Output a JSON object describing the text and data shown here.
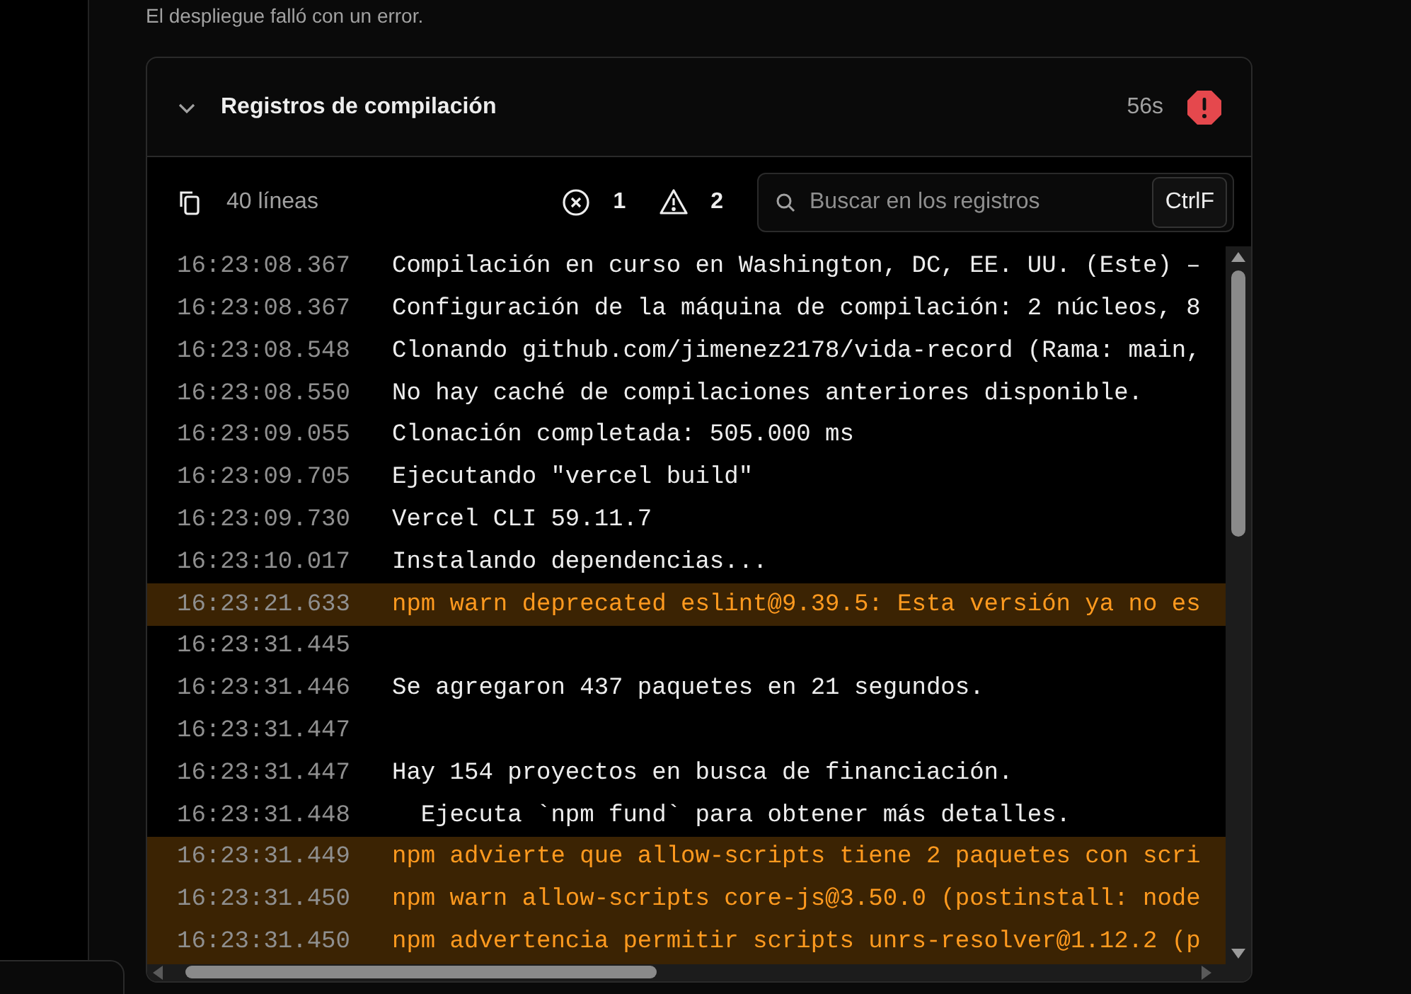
{
  "message": "El despliegue falló con un error.",
  "panel": {
    "title": "Registros de compilación",
    "expanded": true,
    "duration": "56s",
    "failed": true
  },
  "toolbar": {
    "line_count": "40 líneas",
    "errors": "1",
    "warnings": "2",
    "search": {
      "placeholder": "Buscar en los registros",
      "shortcut": "CtrlF"
    }
  },
  "logs": [
    {
      "time": "16:23:08.367",
      "text": "Compilación en curso en Washington, DC, EE. UU. (Este) –",
      "kind": "info"
    },
    {
      "time": "16:23:08.367",
      "text": "Configuración de la máquina de compilación: 2 núcleos, 8",
      "kind": "info"
    },
    {
      "time": "16:23:08.548",
      "text": "Clonando github.com/jimenez2178/vida-record (Rama: main,",
      "kind": "info"
    },
    {
      "time": "16:23:08.550",
      "text": "No hay caché de compilaciones anteriores disponible.",
      "kind": "info"
    },
    {
      "time": "16:23:09.055",
      "text": "Clonación completada: 505.000 ms",
      "kind": "info"
    },
    {
      "time": "16:23:09.705",
      "text": "Ejecutando \"vercel build\"",
      "kind": "info"
    },
    {
      "time": "16:23:09.730",
      "text": "Vercel CLI 59.11.7",
      "kind": "info"
    },
    {
      "time": "16:23:10.017",
      "text": "Instalando dependencias...",
      "kind": "info"
    },
    {
      "time": "16:23:21.633",
      "text": "npm warn deprecated eslint@9.39.5: Esta versión ya no es",
      "kind": "warn"
    },
    {
      "time": "16:23:31.445",
      "kind": "info"
    },
    {
      "time": "16:23:31.446",
      "text": "Se agregaron 437 paquetes en 21 segundos.",
      "kind": "info"
    },
    {
      "time": "16:23:31.447",
      "kind": "info"
    },
    {
      "time": "16:23:31.447",
      "text": "Hay 154 proyectos en busca de financiación.",
      "kind": "info"
    },
    {
      "time": "16:23:31.448",
      "text": "  Ejecuta `npm fund` para obtener más detalles.",
      "kind": "info"
    },
    {
      "time": "16:23:31.449",
      "text": "npm advierte que allow-scripts tiene 2 paquetes con scri",
      "kind": "warn"
    },
    {
      "time": "16:23:31.450",
      "text": "npm warn allow-scripts core-js@3.50.0 (postinstall: node",
      "kind": "warn"
    },
    {
      "time": "16:23:31.450",
      "text": "npm advertencia permitir scripts unrs-resolver@1.12.2 (p",
      "kind": "warn"
    }
  ]
}
